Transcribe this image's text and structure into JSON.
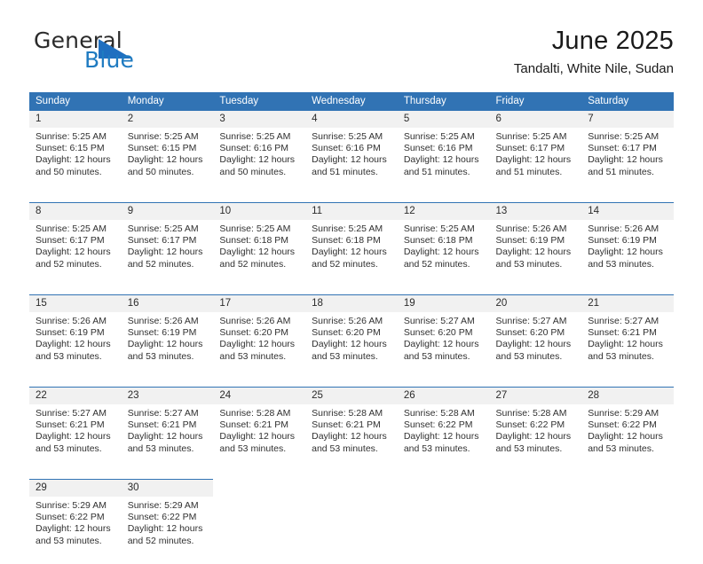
{
  "logo": {
    "word_top": "General",
    "word_bottom": "Blue",
    "triangle_color": "#1f6fc0",
    "blue_color": "#1f7bc1"
  },
  "header": {
    "title": "June 2025",
    "subtitle": "Tandalti, White Nile, Sudan"
  },
  "theme": {
    "header_blue": "#3173b4",
    "daynum_band": "#f1f1f1",
    "text": "#303030"
  },
  "weekdays": [
    "Sunday",
    "Monday",
    "Tuesday",
    "Wednesday",
    "Thursday",
    "Friday",
    "Saturday"
  ],
  "weeks": [
    {
      "days": [
        {
          "num": "1",
          "sunrise": "Sunrise: 5:25 AM",
          "sunset": "Sunset: 6:15 PM",
          "daylight1": "Daylight: 12 hours",
          "daylight2": "and 50 minutes."
        },
        {
          "num": "2",
          "sunrise": "Sunrise: 5:25 AM",
          "sunset": "Sunset: 6:15 PM",
          "daylight1": "Daylight: 12 hours",
          "daylight2": "and 50 minutes."
        },
        {
          "num": "3",
          "sunrise": "Sunrise: 5:25 AM",
          "sunset": "Sunset: 6:16 PM",
          "daylight1": "Daylight: 12 hours",
          "daylight2": "and 50 minutes."
        },
        {
          "num": "4",
          "sunrise": "Sunrise: 5:25 AM",
          "sunset": "Sunset: 6:16 PM",
          "daylight1": "Daylight: 12 hours",
          "daylight2": "and 51 minutes."
        },
        {
          "num": "5",
          "sunrise": "Sunrise: 5:25 AM",
          "sunset": "Sunset: 6:16 PM",
          "daylight1": "Daylight: 12 hours",
          "daylight2": "and 51 minutes."
        },
        {
          "num": "6",
          "sunrise": "Sunrise: 5:25 AM",
          "sunset": "Sunset: 6:17 PM",
          "daylight1": "Daylight: 12 hours",
          "daylight2": "and 51 minutes."
        },
        {
          "num": "7",
          "sunrise": "Sunrise: 5:25 AM",
          "sunset": "Sunset: 6:17 PM",
          "daylight1": "Daylight: 12 hours",
          "daylight2": "and 51 minutes."
        }
      ]
    },
    {
      "days": [
        {
          "num": "8",
          "sunrise": "Sunrise: 5:25 AM",
          "sunset": "Sunset: 6:17 PM",
          "daylight1": "Daylight: 12 hours",
          "daylight2": "and 52 minutes."
        },
        {
          "num": "9",
          "sunrise": "Sunrise: 5:25 AM",
          "sunset": "Sunset: 6:17 PM",
          "daylight1": "Daylight: 12 hours",
          "daylight2": "and 52 minutes."
        },
        {
          "num": "10",
          "sunrise": "Sunrise: 5:25 AM",
          "sunset": "Sunset: 6:18 PM",
          "daylight1": "Daylight: 12 hours",
          "daylight2": "and 52 minutes."
        },
        {
          "num": "11",
          "sunrise": "Sunrise: 5:25 AM",
          "sunset": "Sunset: 6:18 PM",
          "daylight1": "Daylight: 12 hours",
          "daylight2": "and 52 minutes."
        },
        {
          "num": "12",
          "sunrise": "Sunrise: 5:25 AM",
          "sunset": "Sunset: 6:18 PM",
          "daylight1": "Daylight: 12 hours",
          "daylight2": "and 52 minutes."
        },
        {
          "num": "13",
          "sunrise": "Sunrise: 5:26 AM",
          "sunset": "Sunset: 6:19 PM",
          "daylight1": "Daylight: 12 hours",
          "daylight2": "and 53 minutes."
        },
        {
          "num": "14",
          "sunrise": "Sunrise: 5:26 AM",
          "sunset": "Sunset: 6:19 PM",
          "daylight1": "Daylight: 12 hours",
          "daylight2": "and 53 minutes."
        }
      ]
    },
    {
      "days": [
        {
          "num": "15",
          "sunrise": "Sunrise: 5:26 AM",
          "sunset": "Sunset: 6:19 PM",
          "daylight1": "Daylight: 12 hours",
          "daylight2": "and 53 minutes."
        },
        {
          "num": "16",
          "sunrise": "Sunrise: 5:26 AM",
          "sunset": "Sunset: 6:19 PM",
          "daylight1": "Daylight: 12 hours",
          "daylight2": "and 53 minutes."
        },
        {
          "num": "17",
          "sunrise": "Sunrise: 5:26 AM",
          "sunset": "Sunset: 6:20 PM",
          "daylight1": "Daylight: 12 hours",
          "daylight2": "and 53 minutes."
        },
        {
          "num": "18",
          "sunrise": "Sunrise: 5:26 AM",
          "sunset": "Sunset: 6:20 PM",
          "daylight1": "Daylight: 12 hours",
          "daylight2": "and 53 minutes."
        },
        {
          "num": "19",
          "sunrise": "Sunrise: 5:27 AM",
          "sunset": "Sunset: 6:20 PM",
          "daylight1": "Daylight: 12 hours",
          "daylight2": "and 53 minutes."
        },
        {
          "num": "20",
          "sunrise": "Sunrise: 5:27 AM",
          "sunset": "Sunset: 6:20 PM",
          "daylight1": "Daylight: 12 hours",
          "daylight2": "and 53 minutes."
        },
        {
          "num": "21",
          "sunrise": "Sunrise: 5:27 AM",
          "sunset": "Sunset: 6:21 PM",
          "daylight1": "Daylight: 12 hours",
          "daylight2": "and 53 minutes."
        }
      ]
    },
    {
      "days": [
        {
          "num": "22",
          "sunrise": "Sunrise: 5:27 AM",
          "sunset": "Sunset: 6:21 PM",
          "daylight1": "Daylight: 12 hours",
          "daylight2": "and 53 minutes."
        },
        {
          "num": "23",
          "sunrise": "Sunrise: 5:27 AM",
          "sunset": "Sunset: 6:21 PM",
          "daylight1": "Daylight: 12 hours",
          "daylight2": "and 53 minutes."
        },
        {
          "num": "24",
          "sunrise": "Sunrise: 5:28 AM",
          "sunset": "Sunset: 6:21 PM",
          "daylight1": "Daylight: 12 hours",
          "daylight2": "and 53 minutes."
        },
        {
          "num": "25",
          "sunrise": "Sunrise: 5:28 AM",
          "sunset": "Sunset: 6:21 PM",
          "daylight1": "Daylight: 12 hours",
          "daylight2": "and 53 minutes."
        },
        {
          "num": "26",
          "sunrise": "Sunrise: 5:28 AM",
          "sunset": "Sunset: 6:22 PM",
          "daylight1": "Daylight: 12 hours",
          "daylight2": "and 53 minutes."
        },
        {
          "num": "27",
          "sunrise": "Sunrise: 5:28 AM",
          "sunset": "Sunset: 6:22 PM",
          "daylight1": "Daylight: 12 hours",
          "daylight2": "and 53 minutes."
        },
        {
          "num": "28",
          "sunrise": "Sunrise: 5:29 AM",
          "sunset": "Sunset: 6:22 PM",
          "daylight1": "Daylight: 12 hours",
          "daylight2": "and 53 minutes."
        }
      ]
    },
    {
      "days": [
        {
          "num": "29",
          "sunrise": "Sunrise: 5:29 AM",
          "sunset": "Sunset: 6:22 PM",
          "daylight1": "Daylight: 12 hours",
          "daylight2": "and 53 minutes."
        },
        {
          "num": "30",
          "sunrise": "Sunrise: 5:29 AM",
          "sunset": "Sunset: 6:22 PM",
          "daylight1": "Daylight: 12 hours",
          "daylight2": "and 52 minutes."
        },
        {
          "num": "",
          "sunrise": "",
          "sunset": "",
          "daylight1": "",
          "daylight2": ""
        },
        {
          "num": "",
          "sunrise": "",
          "sunset": "",
          "daylight1": "",
          "daylight2": ""
        },
        {
          "num": "",
          "sunrise": "",
          "sunset": "",
          "daylight1": "",
          "daylight2": ""
        },
        {
          "num": "",
          "sunrise": "",
          "sunset": "",
          "daylight1": "",
          "daylight2": ""
        },
        {
          "num": "",
          "sunrise": "",
          "sunset": "",
          "daylight1": "",
          "daylight2": ""
        }
      ]
    }
  ]
}
